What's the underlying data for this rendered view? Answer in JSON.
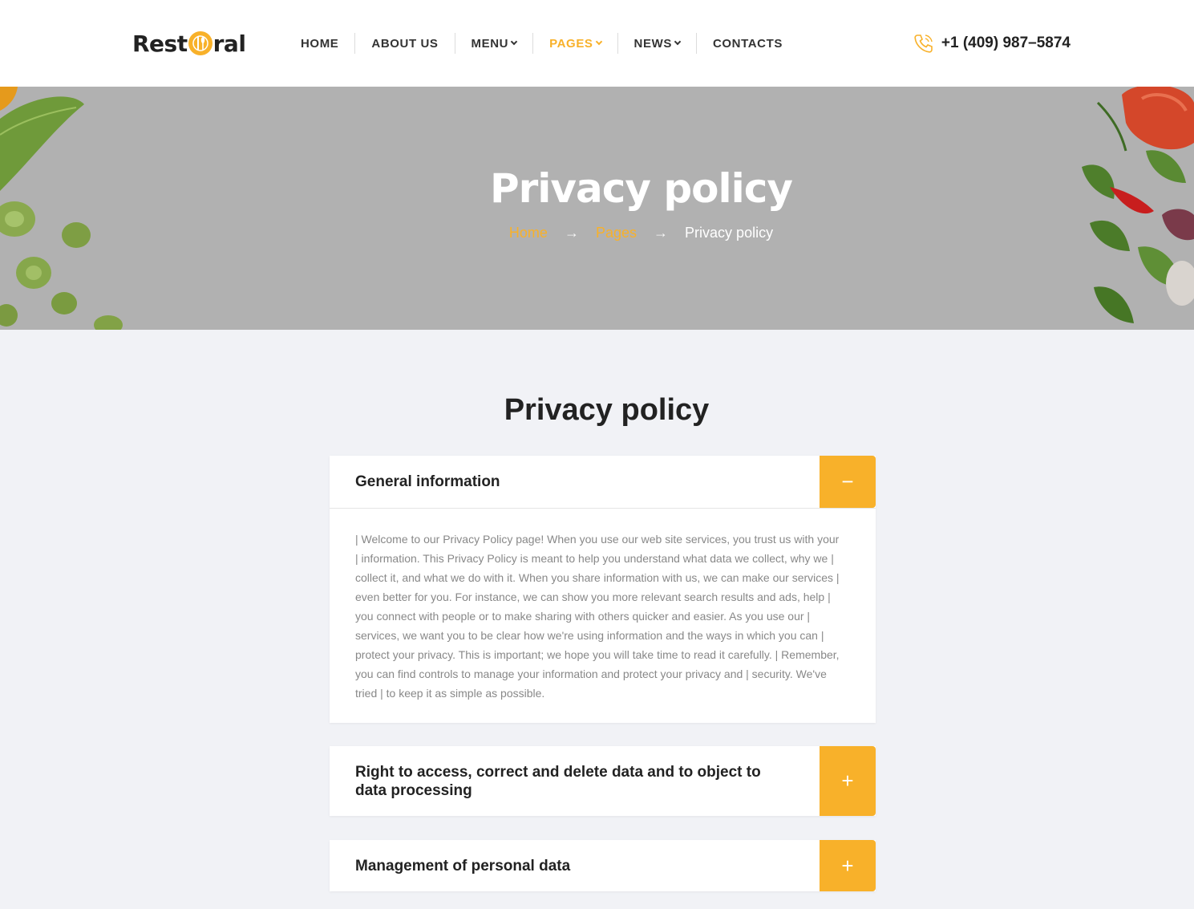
{
  "brand": {
    "logo_left": "Rest",
    "logo_right": "ral",
    "accent_color": "#f8b12a"
  },
  "nav": {
    "items": [
      {
        "label": "HOME",
        "dropdown": false,
        "active": false
      },
      {
        "label": "ABOUT US",
        "dropdown": false,
        "active": false
      },
      {
        "label": "MENU",
        "dropdown": true,
        "active": false
      },
      {
        "label": "PAGES",
        "dropdown": true,
        "active": true
      },
      {
        "label": "NEWS",
        "dropdown": true,
        "active": false
      },
      {
        "label": "CONTACTS",
        "dropdown": false,
        "active": false
      }
    ]
  },
  "header": {
    "phone": "+1 (409) 987–5874",
    "phone_icon": "phone-icon"
  },
  "hero": {
    "title": "Privacy policy",
    "breadcrumb": {
      "home": "Home",
      "pages": "Pages",
      "current": "Privacy policy",
      "separator": "→"
    }
  },
  "main": {
    "title": "Privacy policy",
    "accordion": [
      {
        "title": "General information",
        "expanded": true,
        "toggle": "−",
        "body": "| Welcome to our Privacy Policy page! When you use our web site services, you trust us with your | information. This Privacy Policy is meant to help you understand what data we collect, why we | collect it, and what we do with it. When you share information with us, we can make our services | even better for you. For instance, we can show you more relevant search results and ads, help | you connect with people or to make sharing with others quicker and easier. As you use our | services, we want you to be clear how we're using information and the ways in which you can | protect your privacy. This is important; we hope you will take time to read it carefully. | Remember, you can find controls to manage your information and protect your privacy and | security. We've tried | to keep it as simple as possible."
      },
      {
        "title": "Right to access, correct and delete data and to object to data processing",
        "expanded": false,
        "toggle": "+"
      },
      {
        "title": "Management of personal data",
        "expanded": false,
        "toggle": "+"
      }
    ]
  }
}
